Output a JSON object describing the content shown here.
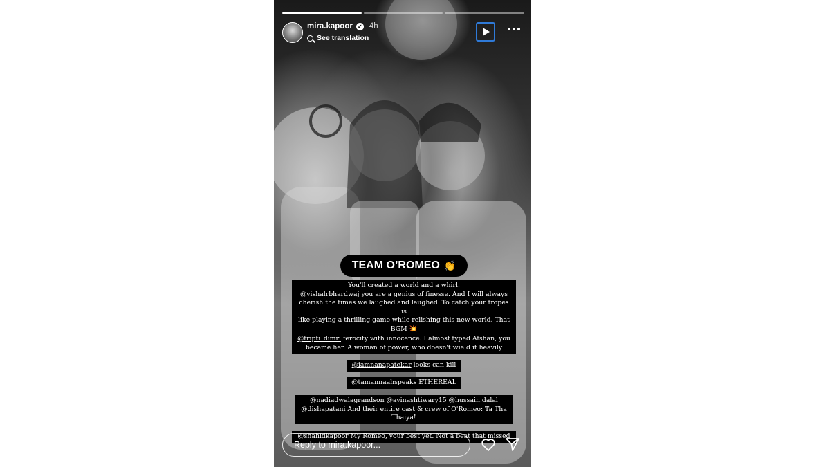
{
  "story": {
    "progress": [
      1.0,
      0.0,
      0.0
    ],
    "header": {
      "username": "mira.kapoor",
      "verified_icon": "verified-badge-icon",
      "time": "4h",
      "translation_link": "See translation"
    },
    "controls": {
      "play_icon": "play-icon",
      "more_icon": "more-options-icon"
    },
    "sticker": {
      "text": "TEAM O’ROMEO",
      "emoji": "👏"
    },
    "text_boxes": [
      {
        "lines": [
          [
            {
              "t": "You'll created a world and a whirl."
            }
          ],
          [
            {
              "t": "@vishalrbhardwaj",
              "m": true
            },
            {
              "t": " you are a genius of finesse. And I will always"
            }
          ],
          [
            {
              "t": "cherish the times we laughed and laughed. To catch your tropes is"
            }
          ],
          [
            {
              "t": "like playing a thrilling game while relishing this new world. That"
            }
          ],
          [
            {
              "t": "BGM "
            },
            {
              "e": "💥"
            }
          ]
        ]
      },
      {
        "lines": [
          [
            {
              "t": "@tripti_dimri",
              "m": true
            },
            {
              "t": " ferocity with innocence. I almost typed Afshan, you"
            }
          ],
          [
            {
              "t": "became her. A woman of power, who doesn't wield it heavily"
            }
          ]
        ]
      },
      {
        "lines": [
          [
            {
              "t": "@iamnanapatekar",
              "m": true
            },
            {
              "t": " looks can kill"
            }
          ]
        ]
      },
      {
        "lines": [
          [
            {
              "t": "@tamannaahspeaks",
              "m": true
            },
            {
              "t": " ETHEREAL"
            }
          ]
        ]
      },
      {
        "lines": [
          [
            {
              "t": "@nadiadwalagrandson",
              "m": true
            },
            {
              "t": " "
            },
            {
              "t": "@avinashtiwary15",
              "m": true
            },
            {
              "t": " "
            },
            {
              "t": "@hussain.dalal",
              "m": true
            }
          ],
          [
            {
              "t": "@dishapatani",
              "m": true
            },
            {
              "t": "  And their entire cast & crew of O'Romeo: Ta Tha"
            }
          ],
          [
            {
              "t": "Thaiya!"
            }
          ]
        ]
      },
      {
        "lines": [
          [
            {
              "t": "@shahidkapoor",
              "m": true
            },
            {
              "t": " My Romeo, your best yet. Not a beat that missed"
            }
          ]
        ]
      }
    ],
    "reply": {
      "placeholder": "Reply to mira.kapoor...",
      "like_icon": "heart-icon",
      "send_icon": "send-icon"
    }
  }
}
